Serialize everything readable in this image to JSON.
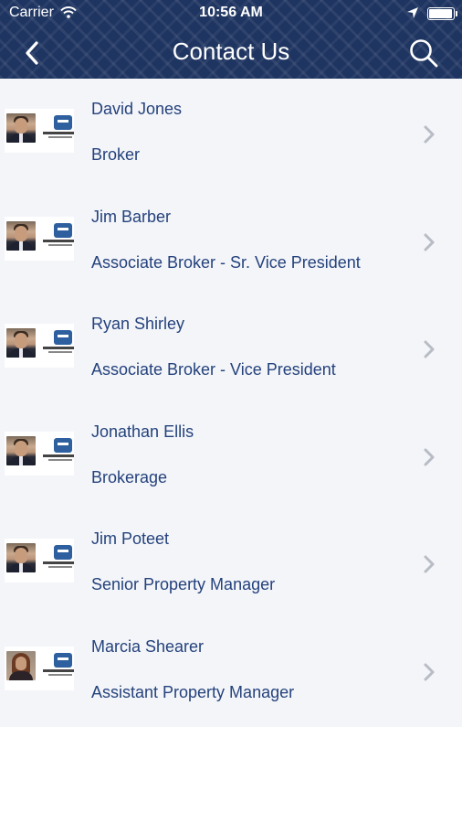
{
  "status_bar": {
    "carrier": "Carrier",
    "time": "10:56 AM",
    "battery_level": 0.95
  },
  "nav": {
    "title": "Contact Us",
    "back_icon": "chevron-left-icon",
    "search_icon": "search-icon"
  },
  "contacts": [
    {
      "name": "David Jones",
      "title": "Broker",
      "photo": "male"
    },
    {
      "name": "Jim Barber",
      "title": "Associate Broker - Sr. Vice President",
      "photo": "male"
    },
    {
      "name": "Ryan Shirley",
      "title": "Associate Broker - Vice President",
      "photo": "male"
    },
    {
      "name": "Jonathan Ellis",
      "title": "Brokerage",
      "photo": "male"
    },
    {
      "name": "Jim Poteet",
      "title": "Senior Property Manager",
      "photo": "male"
    },
    {
      "name": "Marcia Shearer",
      "title": "Assistant Property Manager",
      "photo": "female"
    }
  ],
  "colors": {
    "header": "#1f3561",
    "text": "#25427c",
    "list_bg": "#f3f5f9"
  }
}
